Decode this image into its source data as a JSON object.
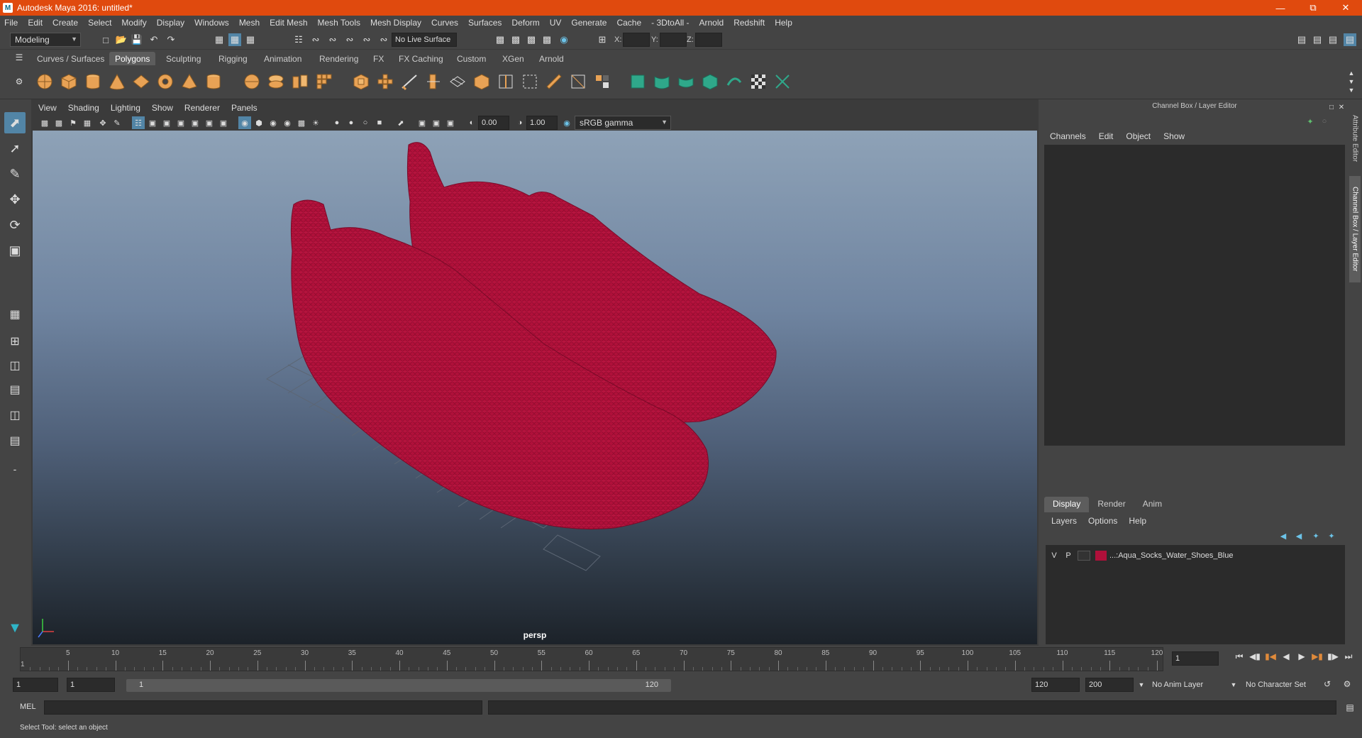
{
  "window": {
    "title": "Autodesk Maya 2016: untitled*",
    "app_icon": "maya-logo-icon"
  },
  "menu": [
    "File",
    "Edit",
    "Create",
    "Select",
    "Modify",
    "Display",
    "Windows",
    "Mesh",
    "Edit Mesh",
    "Mesh Tools",
    "Mesh Display",
    "Curves",
    "Surfaces",
    "Deform",
    "UV",
    "Generate",
    "Cache",
    "- 3DtoAll -",
    "Arnold",
    "Redshift",
    "Help"
  ],
  "status_line": {
    "mode": "Modeling",
    "live_surface": "No Live Surface",
    "coord_labels": {
      "x": "X:",
      "y": "Y:",
      "z": "Z:"
    }
  },
  "shelf": {
    "tabs": [
      "Curves / Surfaces",
      "Polygons",
      "Sculpting",
      "Rigging",
      "Animation",
      "Rendering",
      "FX",
      "FX Caching",
      "Custom",
      "XGen",
      "Arnold"
    ],
    "active_tab": "Polygons"
  },
  "viewport": {
    "menu": [
      "View",
      "Shading",
      "Lighting",
      "Show",
      "Renderer",
      "Panels"
    ],
    "exposure": "0.00",
    "gamma": "1.00",
    "color_space": "sRGB gamma",
    "camera_label": "persp",
    "mesh_color": "#b0103a"
  },
  "channel_box": {
    "title": "Channel Box / Layer Editor",
    "menu": [
      "Channels",
      "Edit",
      "Object",
      "Show"
    ]
  },
  "layer_editor": {
    "tabs": [
      "Display",
      "Render",
      "Anim"
    ],
    "active_tab": "Display",
    "menu": [
      "Layers",
      "Options",
      "Help"
    ],
    "layers": [
      {
        "v": "V",
        "p": "P",
        "color": "#b0103a",
        "name": "...:Aqua_Socks_Water_Shoes_Blue"
      }
    ]
  },
  "side_tabs": [
    "Attribute Editor",
    "Channel Box / Layer Editor"
  ],
  "time_slider": {
    "ticks": [
      "5",
      "10",
      "15",
      "20",
      "25",
      "30",
      "35",
      "40",
      "45",
      "50",
      "55",
      "60",
      "65",
      "70",
      "75",
      "80",
      "85",
      "90",
      "95",
      "100",
      "105",
      "110",
      "115",
      "120"
    ],
    "start_label": "1",
    "current_frame": "1"
  },
  "range_slider": {
    "start": "1",
    "playback_start": "1",
    "range_start_label": "1",
    "range_end_label": "120",
    "playback_end": "120",
    "end": "200",
    "anim_layer": "No Anim Layer",
    "character_set": "No Character Set"
  },
  "command_line": {
    "label": "MEL"
  },
  "help_line": {
    "text": "Select Tool: select an object"
  }
}
